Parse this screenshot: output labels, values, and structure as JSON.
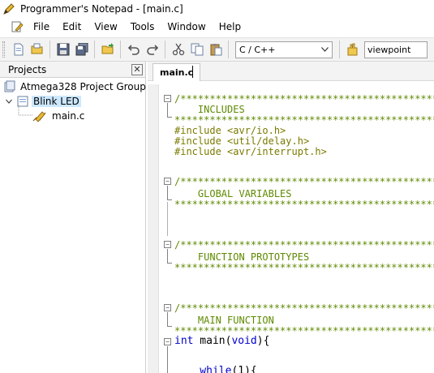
{
  "window": {
    "title": "Programmer's Notepad - [main.c]"
  },
  "menu": {
    "items": [
      "File",
      "Edit",
      "View",
      "Tools",
      "Window",
      "Help"
    ]
  },
  "toolbar": {
    "language_select": "C / C++",
    "search_value": "viewpoint"
  },
  "projects": {
    "header": "Projects",
    "close_glyph": "✕",
    "group": "Atmega328 Project Group",
    "project": "Blink LED",
    "file": "main.c"
  },
  "editor": {
    "tab_label": "main.c",
    "fold_minus": "−",
    "stars": "/*******************************************************",
    "stars_end": "*******************************************************",
    "lines": {
      "includes": "    INCLUDES",
      "inc1": "#include <avr/io.h>",
      "inc2": "#include <util/delay.h>",
      "inc3": "#include <avr/interrupt.h>",
      "globals": "    GLOBAL VARIABLES",
      "protos": "    FUNCTION PROTOTYPES",
      "mainfn": "    MAIN FUNCTION",
      "main_kw": "int",
      "main_name": " main(",
      "main_void": "void",
      "main_close": "){",
      "while_kw": "    while",
      "while_rest": "(1){"
    }
  }
}
